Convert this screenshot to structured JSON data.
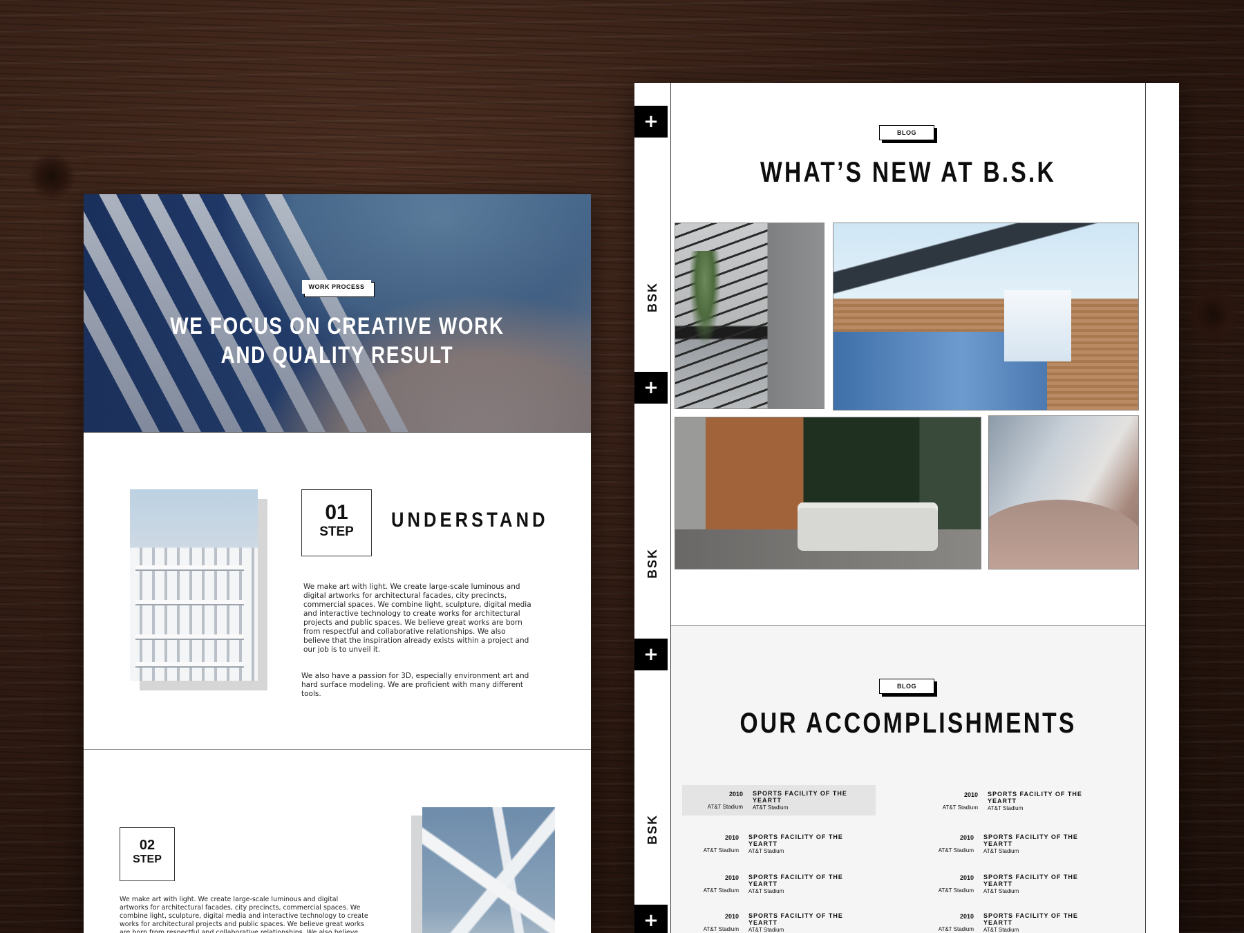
{
  "left_card": {
    "hero": {
      "badge": "WORK PROCESS",
      "title_line1": "WE FOCUS ON CREATIVE WORK",
      "title_line2": "AND QUALITY RESULT"
    },
    "step1": {
      "number": "01",
      "label": "STEP",
      "heading": "UNDERSTAND",
      "paragraph1": "We make art with light. We create large-scale luminous and digital artworks for architectural facades, city precincts, commercial spaces. We combine light, sculpture, digital media and interactive technology to create works for architectural projects and public spaces. We believe great works are born from respectful and collaborative relationships. We also believe that the inspiration already exists within a project and our job is to unveil it.",
      "paragraph2": "We also have a passion for 3D, especially environment art and hard surface modeling. We are proficient with many different tools."
    },
    "step2": {
      "number": "02",
      "label": "STEP",
      "paragraph1": "We make art with light. We create large-scale luminous and digital artworks for architectural facades, city precincts, commercial spaces. We combine light, sculpture, digital media and interactive technology to create works for architectural projects and public spaces. We believe great works are born from respectful and collaborative relationships. We also believe that the inspiration already exists within a project and our job is to unveil it."
    }
  },
  "right_card": {
    "side_buttons": [
      "+",
      "+",
      "+",
      "+"
    ],
    "side_labels": [
      "BSK",
      "BSK",
      "BSK"
    ],
    "news": {
      "badge": "BLOG",
      "title": "WHAT’S NEW AT B.S.K"
    },
    "accomplishments": {
      "badge": "BLOG",
      "title": "OUR ACCOMPLISHMENTS",
      "items": [
        {
          "year": "2010",
          "title": "SPORTS FACILITY OF THE YEARTT",
          "venue": "AT&T Stadium",
          "venue2": "AT&T Stadium"
        },
        {
          "year": "2010",
          "title": "SPORTS FACILITY OF THE YEARTT",
          "venue": "AT&T Stadium",
          "venue2": "AT&T Stadium"
        },
        {
          "year": "2010",
          "title": "SPORTS FACILITY OF THE YEARTT",
          "venue": "AT&T Stadium",
          "venue2": "AT&T Stadium"
        },
        {
          "year": "2010",
          "title": "SPORTS FACILITY OF THE YEARTT",
          "venue": "AT&T Stadium",
          "venue2": "AT&T Stadium"
        },
        {
          "year": "2010",
          "title": "SPORTS FACILITY OF THE YEARTT",
          "venue": "AT&T Stadium",
          "venue2": "AT&T Stadium"
        },
        {
          "year": "2010",
          "title": "SPORTS FACILITY OF THE YEARTT",
          "venue": "AT&T Stadium",
          "venue2": "AT&T Stadium"
        },
        {
          "year": "2010",
          "title": "SPORTS FACILITY OF THE YEARTT",
          "venue": "AT&T Stadium",
          "venue2": "AT&T Stadium"
        },
        {
          "year": "2010",
          "title": "SPORTS FACILITY OF THE YEARTT",
          "venue": "AT&T Stadium",
          "venue2": "AT&T Stadium"
        }
      ]
    }
  }
}
